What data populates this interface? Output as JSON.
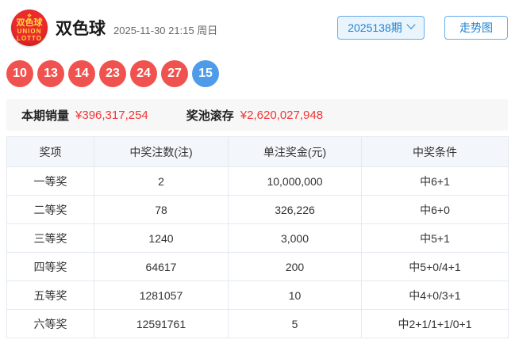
{
  "header": {
    "logo": {
      "crown": "❖",
      "line1": "双色球",
      "line2": "UNION",
      "line3": "LOTTO"
    },
    "title": "双色球",
    "datetime": "2025-11-30 21:15 周日",
    "issue_selector": "2025138期",
    "trend_button": "走势图"
  },
  "draw": {
    "red_balls": [
      "10",
      "13",
      "14",
      "23",
      "24",
      "27"
    ],
    "blue_ball": "15"
  },
  "stats": {
    "sales_label": "本期销量",
    "sales_value": "¥396,317,254",
    "pool_label": "奖池滚存",
    "pool_value": "¥2,620,027,948"
  },
  "prize_table": {
    "headers": [
      "奖项",
      "中奖注数(注)",
      "单注奖金(元)",
      "中奖条件"
    ],
    "rows": [
      [
        "一等奖",
        "2",
        "10,000,000",
        "中6+1"
      ],
      [
        "二等奖",
        "78",
        "326,226",
        "中6+0"
      ],
      [
        "三等奖",
        "1240",
        "3,000",
        "中5+1"
      ],
      [
        "四等奖",
        "64617",
        "200",
        "中5+0/4+1"
      ],
      [
        "五等奖",
        "1281057",
        "10",
        "中4+0/3+1"
      ],
      [
        "六等奖",
        "12591761",
        "5",
        "中2+1/1+1/0+1"
      ]
    ]
  },
  "colors": {
    "red_ball": "#f0534f",
    "blue_ball": "#4e9ce9",
    "accent_blue": "#1d82d2",
    "value_red": "#f23535"
  }
}
